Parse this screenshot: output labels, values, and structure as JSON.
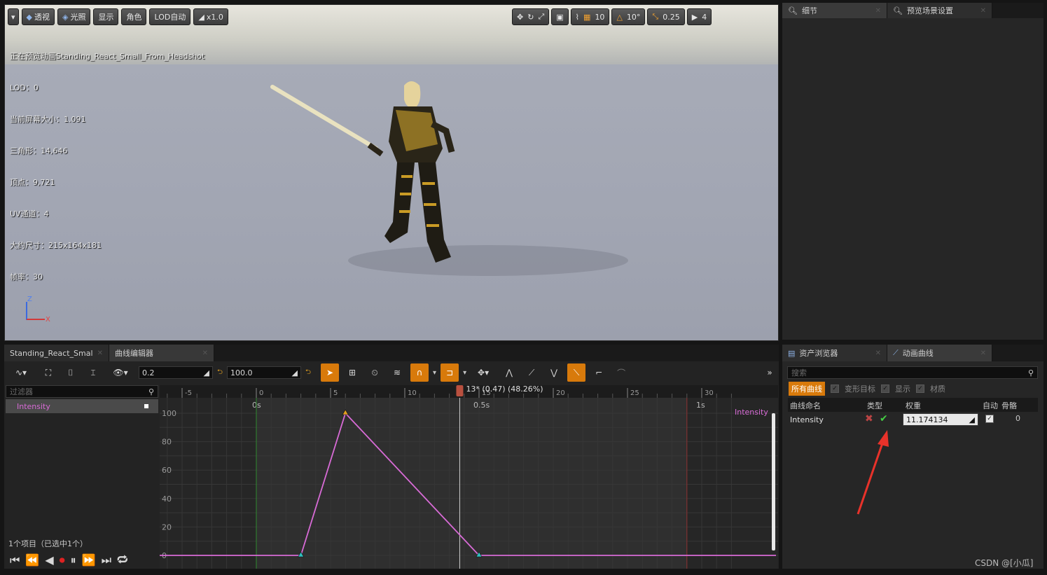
{
  "viewport": {
    "toolbar": {
      "perspective": "透视",
      "lighting": "光照",
      "show": "显示",
      "character": "角色",
      "lod": "LOD自动",
      "speed": "x1.0",
      "grid_snap": "10",
      "rotate_snap": "10°",
      "scale_snap": "0.25",
      "camera_speed": "4"
    },
    "stats": [
      "正在预览动画Standing_React_Small_From_Headshot",
      "LOD：0",
      "当前屏幕大小：1.091",
      "三角形：14,646",
      "顶点：9,721",
      "UV通道：4",
      "大约尺寸：215x164x181",
      "帧率：30"
    ],
    "axis": {
      "z": "Z",
      "x": "X"
    }
  },
  "top_right": {
    "tabs": [
      {
        "label": "细节"
      },
      {
        "label": "预览场景设置"
      }
    ]
  },
  "bottom_left": {
    "tabs": [
      {
        "label": "Standing_React_Smal"
      },
      {
        "label": "曲线编辑器"
      }
    ],
    "fields": {
      "low": "0.2",
      "high": "100.0"
    },
    "filter_placeholder": "过滤器",
    "tree_item": "Intensity",
    "item_count": "1个项目（已选中1个）",
    "playhead": "13* (0.47) (48.26%)",
    "ruler": [
      "-5",
      "0",
      "5",
      "10",
      "15",
      "20",
      "25",
      "30"
    ],
    "time_labels": [
      "0s",
      "0.5s",
      "1s"
    ],
    "y_labels": [
      "100",
      "80",
      "60",
      "40",
      "20",
      "0"
    ],
    "curve_label": "Intensity"
  },
  "bottom_right": {
    "tabs": [
      {
        "label": "资产浏览器"
      },
      {
        "label": "动画曲线"
      }
    ],
    "search_placeholder": "搜索",
    "filters": {
      "all": "所有曲线",
      "morph": "变形目标",
      "show": "显示",
      "material": "材质"
    },
    "columns": {
      "name": "曲线命名",
      "type": "类型",
      "weight": "权重",
      "auto": "自动",
      "bone": "骨骼"
    },
    "row": {
      "name": "Intensity",
      "weight": "11.174134",
      "bone": "0"
    }
  },
  "watermark": "CSDN @[小瓜]",
  "chart_data": {
    "type": "line",
    "series": [
      {
        "name": "Intensity",
        "x": [
          -14,
          3,
          6,
          15,
          35
        ],
        "y": [
          0,
          0,
          100,
          0,
          0
        ]
      }
    ],
    "xlim": [
      -6,
      32
    ],
    "ylim": [
      0,
      100
    ]
  }
}
